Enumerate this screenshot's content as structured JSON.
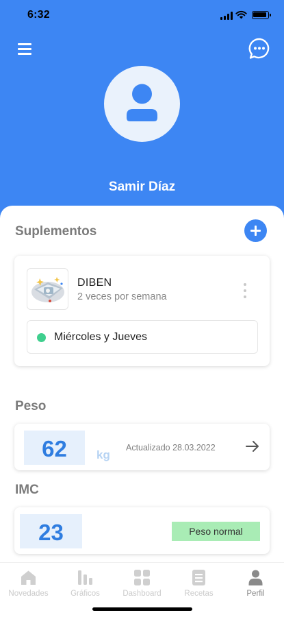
{
  "status_bar": {
    "time": "6:32"
  },
  "profile": {
    "name": "Samir Díaz"
  },
  "supplements": {
    "title": "Suplementos",
    "items": [
      {
        "name": "DIBEN",
        "frequency": "2 veces por semana",
        "days": "Miércoles y Jueves",
        "days_dot_color": "#3fcf8e"
      }
    ]
  },
  "weight": {
    "title": "Peso",
    "value": "62",
    "unit": "kg",
    "updated": "Actualizado 28.03.2022"
  },
  "imc": {
    "title": "IMC",
    "value": "23",
    "status": "Peso normal",
    "status_color": "#a9ecb5"
  },
  "tabs": [
    {
      "label": "Novedades",
      "icon": "home-icon",
      "active": false
    },
    {
      "label": "Gráficos",
      "icon": "bar-chart-icon",
      "active": false
    },
    {
      "label": "Dashboard",
      "icon": "grid-icon",
      "active": false
    },
    {
      "label": "Recetas",
      "icon": "recipe-book-icon",
      "active": false
    },
    {
      "label": "Perfil",
      "icon": "person-icon",
      "active": true
    }
  ],
  "colors": {
    "primary": "#3d86f3",
    "value_text": "#2f7de0",
    "value_bg": "#e6f0fc"
  }
}
